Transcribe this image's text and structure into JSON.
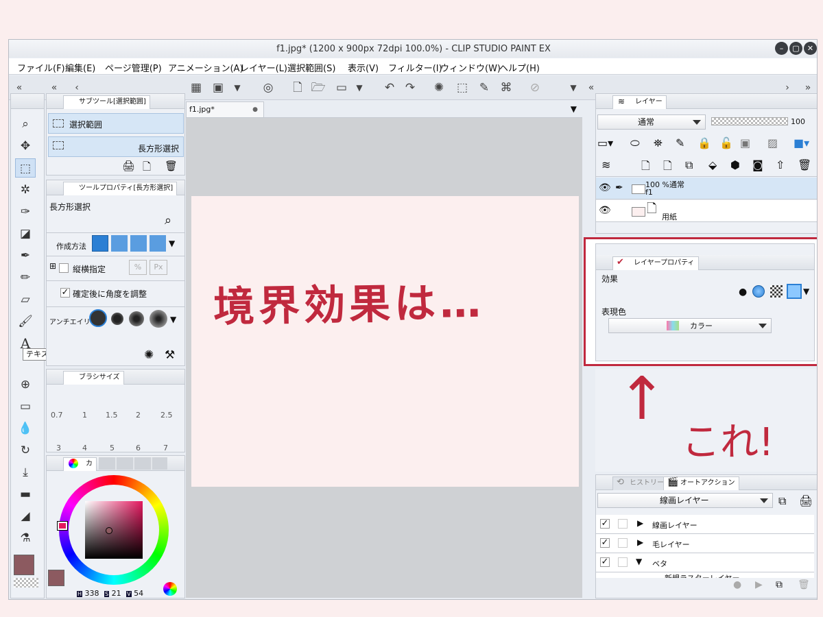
{
  "window": {
    "title": "f1.jpg* (1200 x 900px 72dpi 100.0%) - CLIP STUDIO PAINT EX"
  },
  "menu": [
    "ファイル(F)",
    "編集(E)",
    "ページ管理(P)",
    "アニメーション(A)",
    "レイヤー(L)",
    "選択範囲(S)",
    "表示(V)",
    "フィルター(I)",
    "ウィンドウ(W)",
    "ヘルプ(H)"
  ],
  "canvas_tab": "f1.jpg*",
  "subtool": {
    "tab": "サブツール[選択範囲]",
    "group": "選択範囲",
    "item": "長方形選択"
  },
  "tool_property": {
    "tab": "ツールプロパティ[長方形選択]",
    "name": "長方形選択",
    "create_method_label": "作成方法",
    "aspect_label": "縦横指定",
    "aspect_value_1": "%",
    "aspect_value_2": "Px",
    "confirm_label": "確定後に角度を調整",
    "antialias_label": "アンチエイリ"
  },
  "tooltip": "テキスト(T)",
  "brush_size": {
    "tab": "ブラシサイズ",
    "row1": [
      "0.7",
      "1",
      "1.5",
      "2",
      "2.5"
    ],
    "row2": [
      "3",
      "4",
      "5",
      "6",
      "7"
    ]
  },
  "color": {
    "tab_short": "カ",
    "h_label": "H",
    "h": "338",
    "s_label": "S",
    "s": "21",
    "v_label": "V",
    "v": "54",
    "main_color": "#8c5a60"
  },
  "layer_panel": {
    "tab": "レイヤー",
    "blend_mode": "通常",
    "opacity": "100",
    "layers": [
      {
        "percent": "100 %通常",
        "name": "f1"
      },
      {
        "percent": "",
        "name": "用紙"
      }
    ]
  },
  "layer_property": {
    "tab": "レイヤープロパティ",
    "effect_label": "効果",
    "expression_label": "表現色",
    "expression_value": "カラー"
  },
  "auto_action": {
    "history_tab": "ヒストリー",
    "tab": "オートアクション",
    "set": "線画レイヤー",
    "items": [
      "線画レイヤー",
      "毛レイヤー",
      "ベタ",
      "新規ラスターレイヤー"
    ]
  },
  "annotation": {
    "canvas_text": "境界効果は…",
    "side_text": "これ!",
    "arrow": "↑",
    "color": "#c0293e"
  }
}
